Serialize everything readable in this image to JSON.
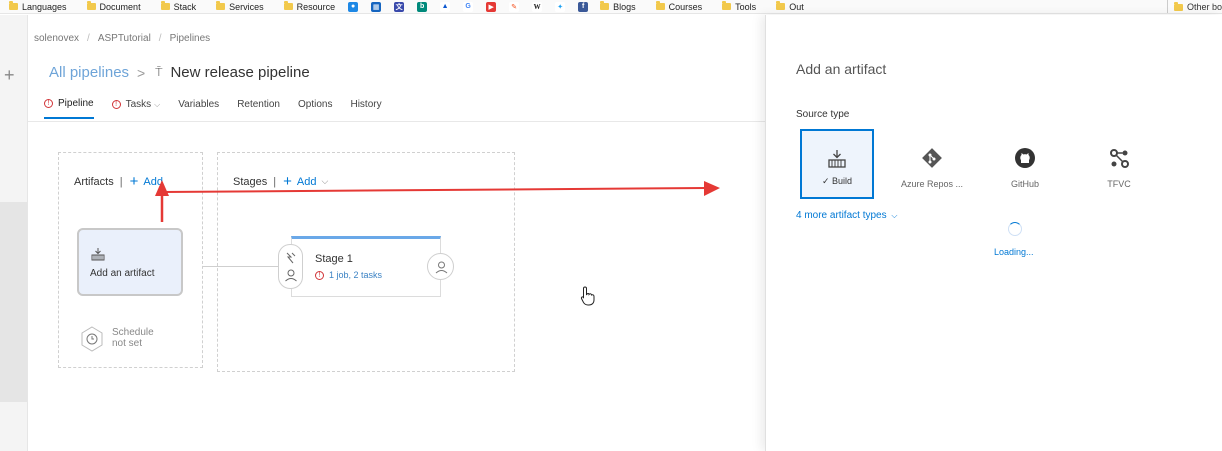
{
  "bookmarks": {
    "folders": [
      "Languages",
      "Document",
      "Stack",
      "Services",
      "Resource"
    ],
    "folders2": [
      "Blogs",
      "Courses",
      "Tools",
      "Out"
    ],
    "other": "Other bo"
  },
  "breadcrumb": [
    "solenovex",
    "ASPTutorial",
    "Pipelines"
  ],
  "title": {
    "all_pipelines": "All pipelines",
    "pipeline_name": "New release pipeline"
  },
  "tabs": [
    "Pipeline",
    "Tasks",
    "Variables",
    "Retention",
    "Options",
    "History"
  ],
  "artifacts": {
    "heading": "Artifacts",
    "add_label": "Add",
    "card_label": "Add an artifact",
    "schedule_line1": "Schedule",
    "schedule_line2": "not set"
  },
  "stages": {
    "heading": "Stages",
    "add_label": "Add",
    "stage_name": "Stage 1",
    "stage_summary": "1 job, 2 tasks"
  },
  "panel": {
    "title": "Add an artifact",
    "source_type_label": "Source type",
    "sources": [
      "Build",
      "Azure Repos ...",
      "GitHub",
      "TFVC"
    ],
    "selected_source": "Build",
    "more_types": "4 more artifact types",
    "loading": "Loading..."
  },
  "colors": {
    "accent": "#0078d4",
    "warning": "#d13438",
    "annotation": "#e53935"
  }
}
